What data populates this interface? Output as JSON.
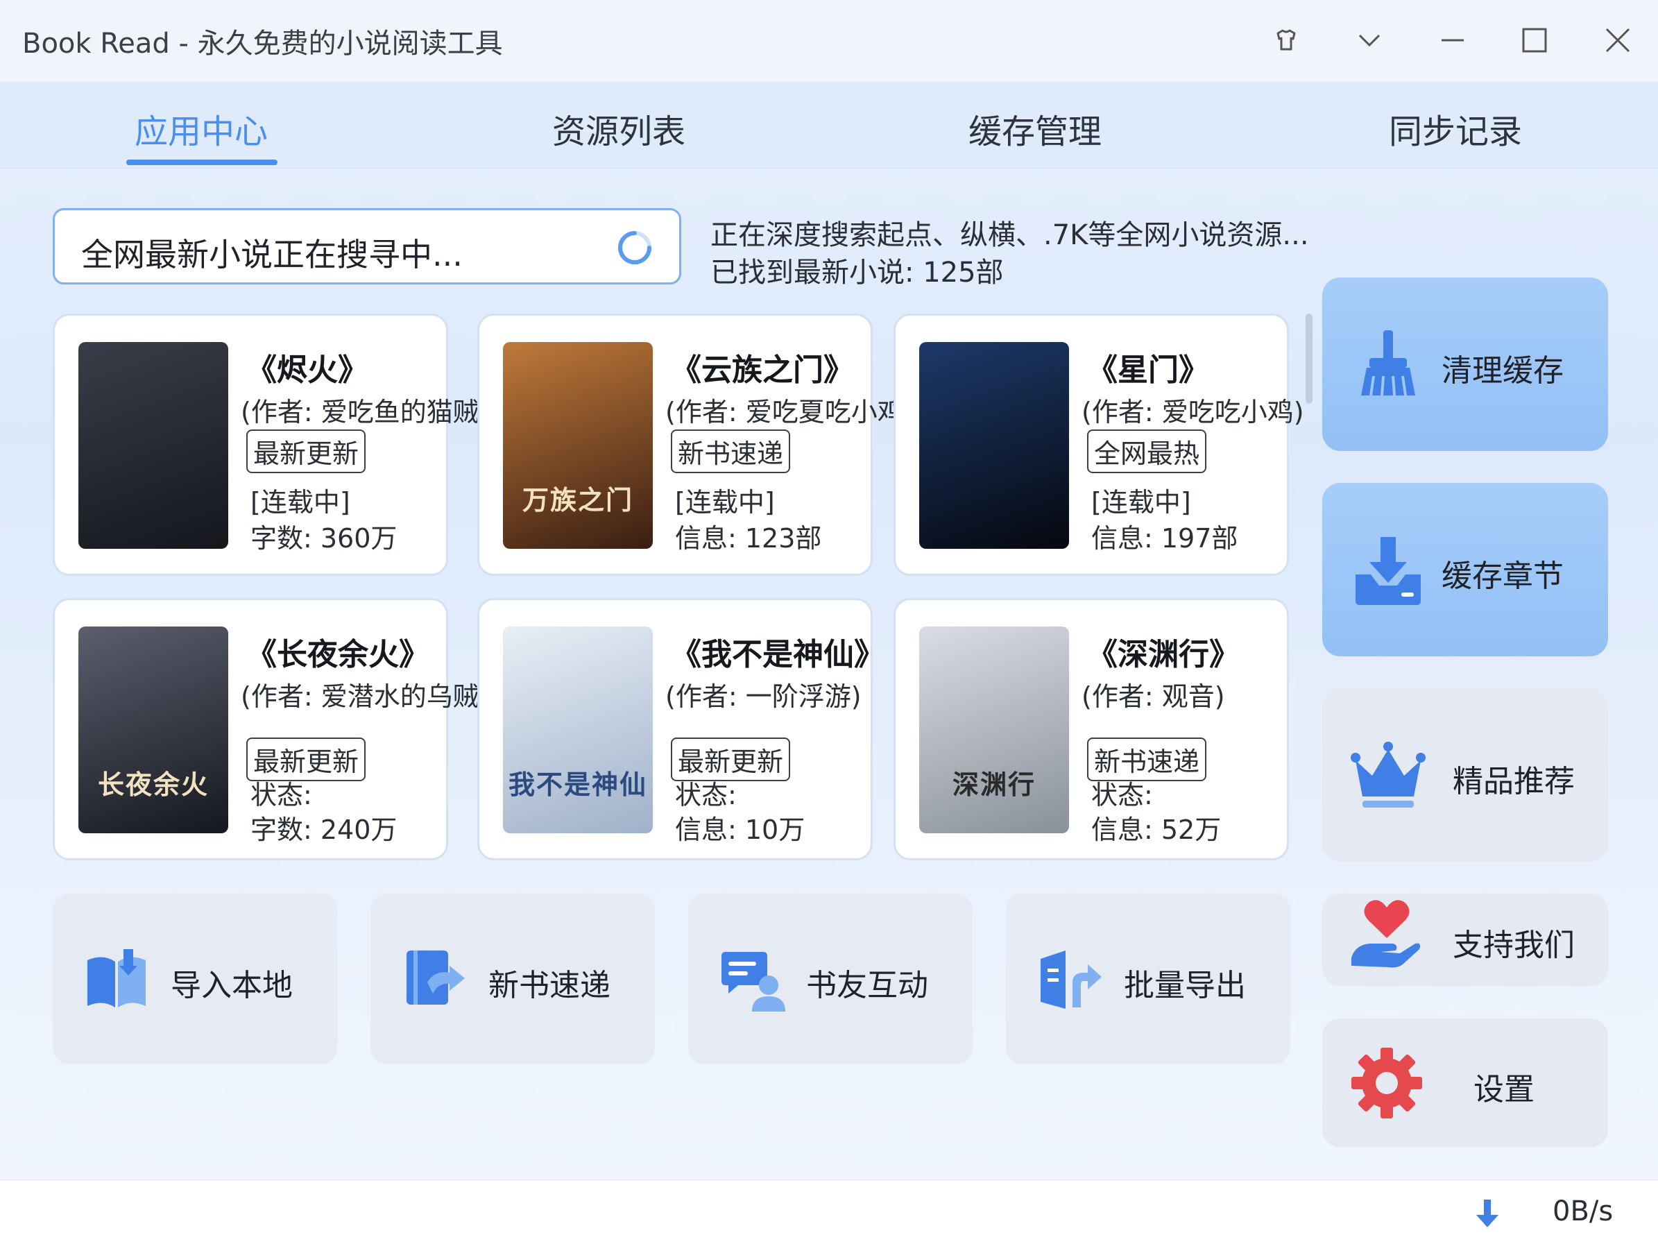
{
  "window": {
    "title": "Book Read - 永久免费的小说阅读工具",
    "controls": [
      "skin-icon",
      "dropdown-icon",
      "minimize-icon",
      "maximize-icon",
      "close-icon"
    ]
  },
  "tabs": [
    {
      "label": "应用中心",
      "active": true
    },
    {
      "label": "资源列表",
      "active": false
    },
    {
      "label": "缓存管理",
      "active": false
    },
    {
      "label": "同步记录",
      "active": false
    }
  ],
  "search": {
    "text": "全网最新小说正在搜寻中...",
    "status_line1": "正在深度搜索起点、纵横、.7K等全网小说资源...",
    "status_line2": "已找到最新小说: 125部"
  },
  "books": [
    {
      "title": "《烬火》",
      "author": "(作者: 爱吃鱼的猫贼)",
      "tag": "最新更新",
      "line1": "[连载中]",
      "line2": "字数: 360万",
      "cover_title": "",
      "cover_colors": [
        "#3a3e4a",
        "#15171d"
      ]
    },
    {
      "title": "《云族之门》",
      "author": "(作者: 爱吃夏吃小鸡)",
      "tag": "新书速递",
      "line1": "[连载中]",
      "line2": "信息: 123部",
      "cover_title": "万族之门",
      "cover_colors": [
        "#c07a3a",
        "#3a1e12"
      ]
    },
    {
      "title": "《星门》",
      "author": "(作者: 爱吃吃小鸡)",
      "tag": "全网最热",
      "line1": "[连载中]",
      "line2": "信息: 197部",
      "cover_title": "",
      "cover_colors": [
        "#1d3a6a",
        "#05080f"
      ]
    },
    {
      "title": "《长夜余火》",
      "author": "(作者: 爱潜水的乌贼)",
      "tag": "最新更新",
      "line1": "状态:",
      "line2": "字数: 240万",
      "cover_title": "长夜余火",
      "cover_colors": [
        "#5b5f6e",
        "#16181f"
      ]
    },
    {
      "title": "《我不是神仙》",
      "author": "(作者: 一阶浮游)",
      "tag": "最新更新",
      "line1": "状态:",
      "line2": "信息: 10万",
      "cover_title": "我不是神仙",
      "cover_colors": [
        "#e8eef6",
        "#9fb1c9"
      ]
    },
    {
      "title": "《深渊行》",
      "author": "(作者: 观音)",
      "tag": "新书速递",
      "line1": "状态:",
      "line2": "信息: 52万",
      "cover_title": "深渊行",
      "cover_colors": [
        "#d9dde3",
        "#8a909a"
      ]
    }
  ],
  "actions": [
    {
      "label": "导入本地",
      "icon": "import-book-icon"
    },
    {
      "label": "新书速递",
      "icon": "new-book-icon"
    },
    {
      "label": "书友互动",
      "icon": "chat-icon"
    },
    {
      "label": "批量导出",
      "icon": "export-icon"
    }
  ],
  "side": [
    {
      "label": "清理缓存",
      "icon": "broom-icon"
    },
    {
      "label": "缓存章节",
      "icon": "download-icon"
    },
    {
      "label": "精品推荐",
      "icon": "crown-icon"
    },
    {
      "label": "支持我们",
      "icon": "heart-hand-icon"
    },
    {
      "label": "设置",
      "icon": "gear-icon"
    }
  ],
  "statusbar": {
    "speed": "0B/s"
  },
  "colors": {
    "accent": "#4a8ff0",
    "icon_blue": "#3f7fe6",
    "side_blue": "#9ec6f7",
    "heart_red": "#e94450",
    "gear_red": "#e5484d"
  }
}
